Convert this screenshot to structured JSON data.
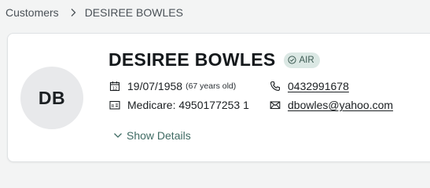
{
  "breadcrumb": {
    "parent": "Customers",
    "current": "DESIREE BOWLES"
  },
  "profile": {
    "initials": "DB",
    "name": "DESIREE BOWLES",
    "badge": "AIR",
    "dob": "19/07/1958",
    "age": "(67 years old)",
    "medicare": "Medicare: 4950177253 1",
    "phone": "0432991678",
    "email": "dbowles@yahoo.com",
    "show_details_label": "Show Details"
  },
  "icons": {
    "separator": "chevron-right-icon",
    "badge": "check-circle-icon",
    "dob": "calendar-icon",
    "medicare": "id-card-icon",
    "phone": "phone-icon",
    "email": "mail-icon",
    "show_details": "chevron-down-icon"
  },
  "colors": {
    "badge_bg": "#dbe8e4",
    "badge_text": "#3c5a52",
    "accent": "#3f6b63"
  }
}
